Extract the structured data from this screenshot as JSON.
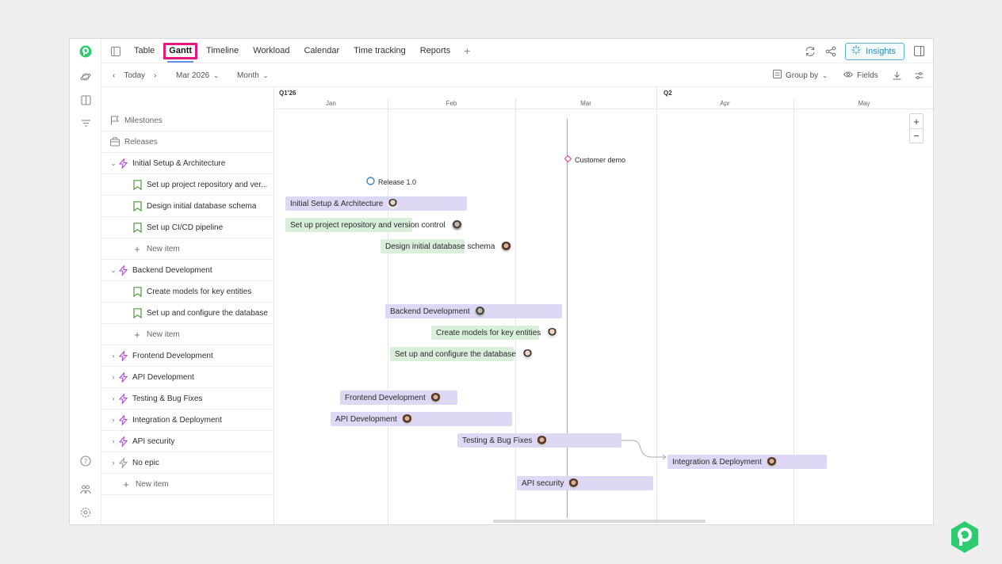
{
  "tabs": [
    {
      "label": "Table",
      "active": false
    },
    {
      "label": "Gantt",
      "active": true
    },
    {
      "label": "Timeline",
      "active": false
    },
    {
      "label": "Workload",
      "active": false
    },
    {
      "label": "Calendar",
      "active": false
    },
    {
      "label": "Time tracking",
      "active": false
    },
    {
      "label": "Reports",
      "active": false
    }
  ],
  "tab_add": "+",
  "insights_label": "Insights",
  "toolbar": {
    "today_label": "Today",
    "date_label": "Mar 2026",
    "scale_label": "Month",
    "group_by_label": "Group by",
    "fields_label": "Fields"
  },
  "left_rows": {
    "milestones": "Milestones",
    "releases": "Releases",
    "epic_setup": "Initial Setup & Architecture",
    "task_repo": "Set up project repository and ver...",
    "task_schema": "Design initial database schema",
    "task_cicd": "Set up CI/CD pipeline",
    "new_item_1": "New item",
    "epic_backend": "Backend Development",
    "task_models": "Create models for key entities",
    "task_db": "Set up and configure the database",
    "new_item_2": "New item",
    "epic_frontend": "Frontend Development",
    "epic_api": "API Development",
    "epic_testing": "Testing & Bug Fixes",
    "epic_integration": "Integration & Deployment",
    "epic_security": "API security",
    "epic_none": "No epic",
    "new_item_3": "New item"
  },
  "timeline": {
    "q1_label": "Q1'26",
    "q2_label": "Q2",
    "months": [
      "Jan",
      "Feb",
      "Mar",
      "Apr",
      "May"
    ]
  },
  "milestones": {
    "customer_demo": "Customer demo",
    "release": "Release 1.0"
  },
  "bars": {
    "setup": "Initial Setup & Architecture",
    "repo": "Set up project repository and version control",
    "schema": "Design initial database schema",
    "backend": "Backend Development",
    "models": "Create models for key entities",
    "db": "Set up and configure the database",
    "frontend": "Frontend Development",
    "api": "API Development",
    "testing": "Testing & Bug Fixes",
    "integration": "Integration & Deployment",
    "security": "API security"
  },
  "zoom": {
    "in": "+",
    "out": "−"
  },
  "colors": {
    "accent": "#e8177e",
    "epic": "#b24bdc",
    "task": "#4a9a3a",
    "brand": "#2ecc71"
  }
}
